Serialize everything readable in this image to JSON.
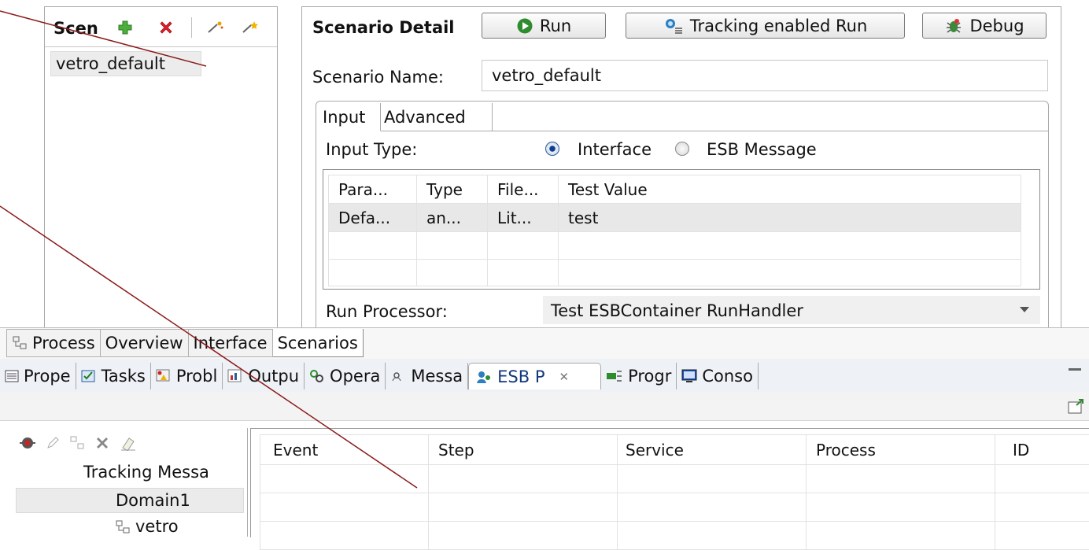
{
  "scenarios_panel": {
    "title": "Scen",
    "items": [
      "vetro_default"
    ],
    "icons": [
      "add-icon",
      "delete-icon",
      "wand-icon",
      "star-wand-icon"
    ]
  },
  "detail": {
    "title": "Scenario Detail",
    "run_label": "Run",
    "tracking_label": "Tracking enabled Run",
    "debug_label": "Debug",
    "name_label": "Scenario Name:",
    "name_value": "vetro_default",
    "tabs": [
      "Input",
      "Advanced"
    ],
    "input_type_label": "Input Type:",
    "radio_interface": "Interface",
    "radio_esb": "ESB Message",
    "table": {
      "columns": [
        "Para...",
        "Type",
        "File...",
        "Test Value"
      ],
      "rows": [
        [
          "Defa...",
          "an...",
          "Lit...",
          "test"
        ]
      ]
    },
    "run_processor_label": "Run Processor:",
    "run_processor_value": "Test ESBContainer RunHandler"
  },
  "editor_tabs": [
    "Process",
    "Overview",
    "Interface",
    "Scenarios"
  ],
  "view_tabs": [
    "Prope",
    "Tasks",
    "Probl",
    "Outpu",
    "Opera",
    "Messa",
    "ESB P",
    "Progr",
    "Conso"
  ],
  "tree": {
    "items": [
      "Tracking Messa",
      "Domain1",
      "vetro"
    ]
  },
  "events_table": {
    "columns": [
      "Event",
      "Step",
      "Service",
      "Process",
      "ID"
    ]
  },
  "colors": {
    "annotation_line": "#8b1a1a",
    "selection": "#e8e8e8"
  }
}
